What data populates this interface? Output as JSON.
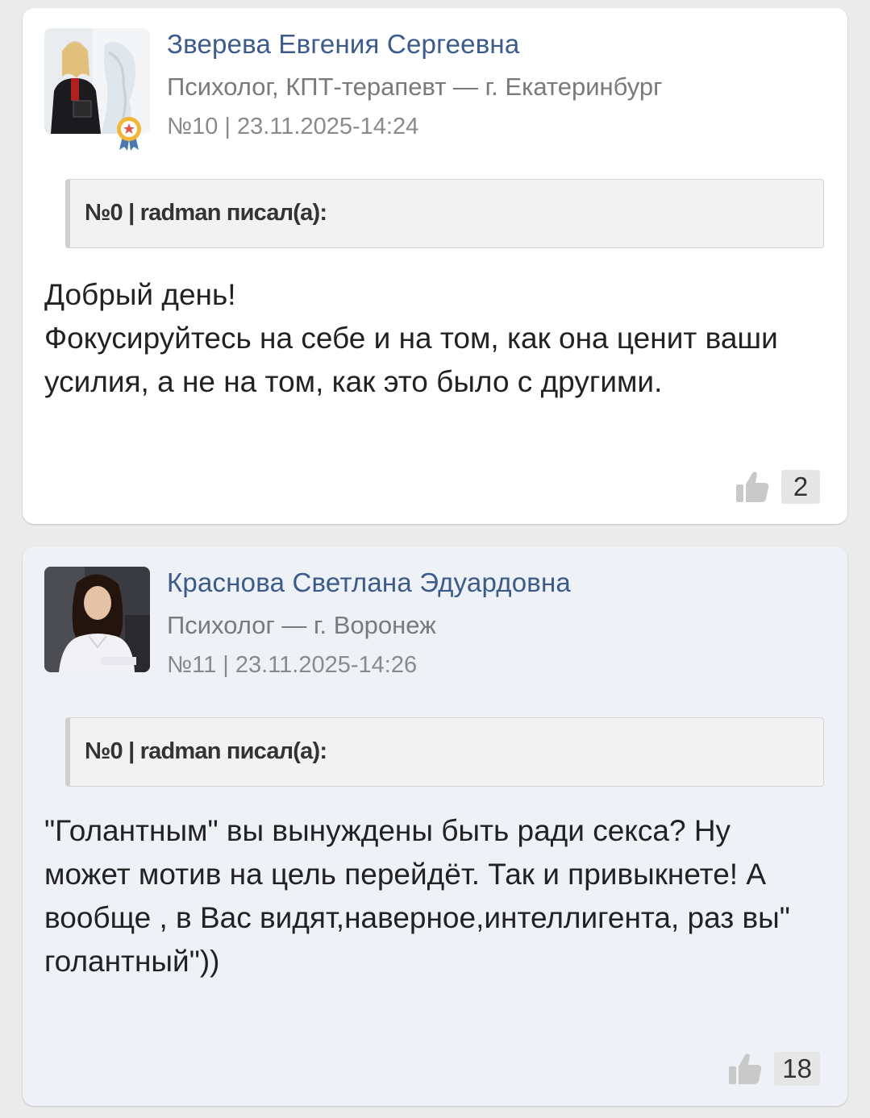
{
  "posts": [
    {
      "author": "Зверева Евгения Сергеевна",
      "role": "Психолог, КПТ-терапевт — г. Екатеринбург",
      "meta": "№10 | 23.11.2025-14:24",
      "quote_header": "№0 | radman писал(а):",
      "text": "Добрый день!\nФокусируйтесь на себе и на том, как она ценит ваши усилия, а не на том, как это было с другими.",
      "likes": "2",
      "avatar_icon": "avatar-photo-woman-blonde",
      "badge_icon": "award-ribbon-icon"
    },
    {
      "author": "Краснова Светлана Эдуардовна",
      "role": "Психолог — г. Воронеж",
      "meta": "№11 | 23.11.2025-14:26",
      "quote_header": "№0 | radman писал(а):",
      "text": "\"Голантным\" вы вынуждены быть ради секса? Ну может мотив на цель перейдёт. Так и привыкнете! А вообще , в Вас видят,наверное,интеллигента, раз вы\" голантный\"))",
      "likes": "18",
      "avatar_icon": "avatar-photo-woman-dark-hair"
    }
  ],
  "colors": {
    "author_link": "#3c5a8a",
    "post1_bg": "#ffffff",
    "post2_bg": "#eef2f7",
    "page_bg": "#ebebeb"
  },
  "icons": {
    "like": "thumbs-up-icon"
  }
}
